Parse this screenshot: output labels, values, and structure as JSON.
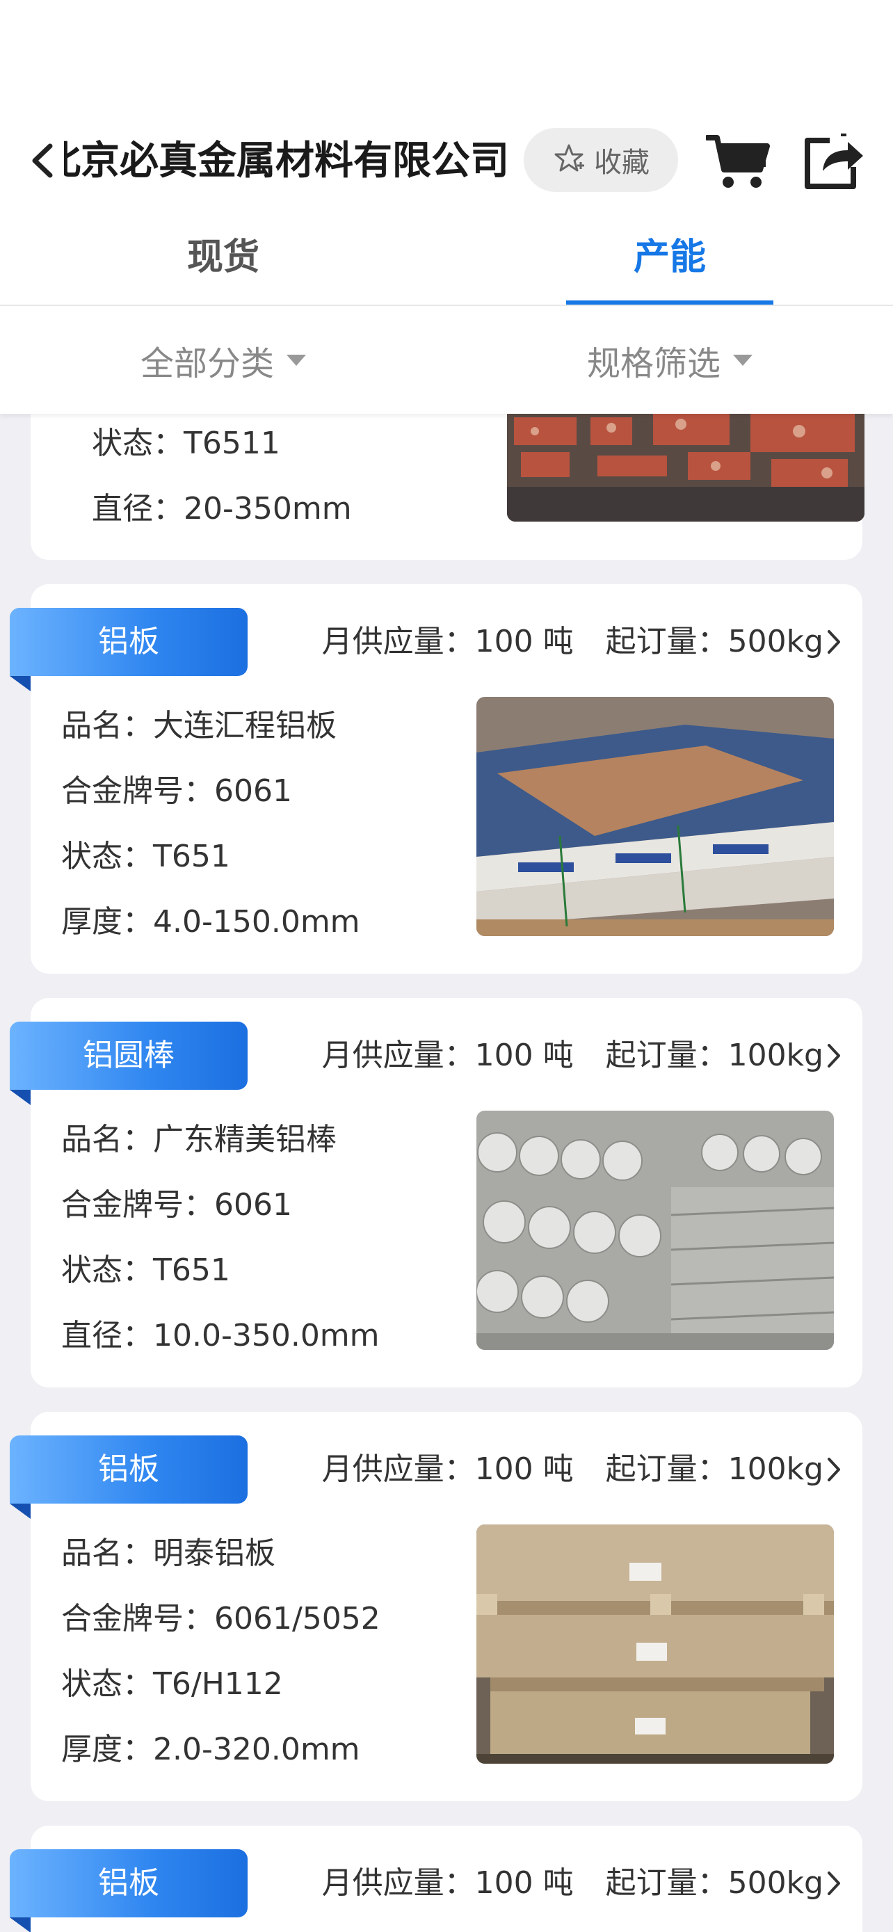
{
  "header": {
    "title": "北京必真金属材料有限公司",
    "favorite_label": "收藏",
    "back_icon": "chevron-left-icon",
    "cart_icon": "cart-icon",
    "share_icon": "share-icon",
    "favorite_icon": "star-plus-icon"
  },
  "tabs": [
    {
      "label": "现货"
    },
    {
      "label": "产能"
    }
  ],
  "active_tab": "产能",
  "filters": [
    {
      "label": "全部分类"
    },
    {
      "label": "规格筛选"
    }
  ],
  "colors": {
    "accent": "#1677e6",
    "background": "#efeff4",
    "ribbon": "#2f86f0"
  },
  "cards": [
    {
      "attrs": [
        {
          "key": "状态：",
          "value": "T6511"
        },
        {
          "key": "直径：",
          "value": "20-350mm"
        }
      ],
      "image": "aluminum-round-bars-rack"
    },
    {
      "category": "铝板",
      "supply_label": "月供应量：",
      "supply_value": "100 吨",
      "moq_label": "起订量：",
      "moq_value": "500kg",
      "attrs": [
        {
          "key": "品名：",
          "value": "大连汇程铝板"
        },
        {
          "key": "合金牌号：",
          "value": "6061"
        },
        {
          "key": "状态：",
          "value": "T651"
        },
        {
          "key": "厚度：",
          "value": "4.0-150.0mm"
        }
      ],
      "image": "aluminum-plate-stack"
    },
    {
      "category": "铝圆棒",
      "supply_label": "月供应量：",
      "supply_value": "100 吨",
      "moq_label": "起订量：",
      "moq_value": "100kg",
      "attrs": [
        {
          "key": "品名：",
          "value": "广东精美铝棒"
        },
        {
          "key": "合金牌号：",
          "value": "6061"
        },
        {
          "key": "状态：",
          "value": "T651"
        },
        {
          "key": "直径：",
          "value": "10.0-350.0mm"
        }
      ],
      "image": "aluminum-round-bars"
    },
    {
      "category": "铝板",
      "supply_label": "月供应量：",
      "supply_value": "100 吨",
      "moq_label": "起订量：",
      "moq_value": "100kg",
      "attrs": [
        {
          "key": "品名：",
          "value": "明泰铝板"
        },
        {
          "key": "合金牌号：",
          "value": "6061/5052"
        },
        {
          "key": "状态：",
          "value": "T6/H112"
        },
        {
          "key": "厚度：",
          "value": "2.0-320.0mm"
        }
      ],
      "image": "aluminum-plate-pallets"
    },
    {
      "category": "铝板",
      "supply_label": "月供应量：",
      "supply_value": "100 吨",
      "moq_label": "起订量：",
      "moq_value": "500kg"
    }
  ]
}
